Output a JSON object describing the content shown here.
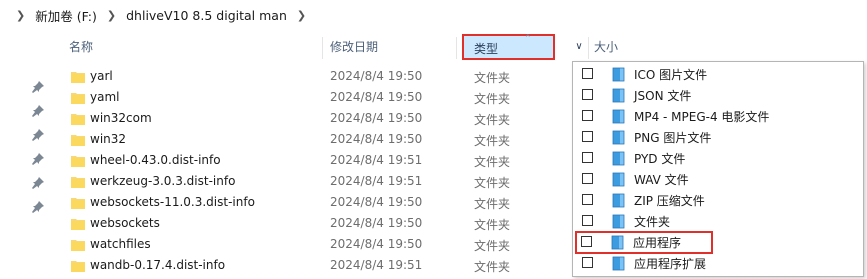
{
  "breadcrumb": {
    "drive": "新加卷 (F:)",
    "folder": "dhliveV10 8.5 digital man"
  },
  "columns": {
    "name": "名称",
    "date": "修改日期",
    "type": "类型",
    "size": "大小"
  },
  "files": [
    {
      "name": "yarl",
      "date": "2024/8/4 19:50",
      "type": "文件夹"
    },
    {
      "name": "yaml",
      "date": "2024/8/4 19:50",
      "type": "文件夹"
    },
    {
      "name": "win32com",
      "date": "2024/8/4 19:50",
      "type": "文件夹"
    },
    {
      "name": "win32",
      "date": "2024/8/4 19:50",
      "type": "文件夹"
    },
    {
      "name": "wheel-0.43.0.dist-info",
      "date": "2024/8/4 19:51",
      "type": "文件夹"
    },
    {
      "name": "werkzeug-3.0.3.dist-info",
      "date": "2024/8/4 19:51",
      "type": "文件夹"
    },
    {
      "name": "websockets-11.0.3.dist-info",
      "date": "2024/8/4 19:50",
      "type": "文件夹"
    },
    {
      "name": "websockets",
      "date": "2024/8/4 19:50",
      "type": "文件夹"
    },
    {
      "name": "watchfiles",
      "date": "2024/8/4 19:50",
      "type": "文件夹"
    },
    {
      "name": "wandb-0.17.4.dist-info",
      "date": "2024/8/4 19:51",
      "type": "文件夹"
    }
  ],
  "filter_options": [
    {
      "label": "ICO 图片文件",
      "checked": false
    },
    {
      "label": "JSON 文件",
      "checked": false
    },
    {
      "label": "MP4 - MPEG-4 电影文件",
      "checked": false
    },
    {
      "label": "PNG 图片文件",
      "checked": false
    },
    {
      "label": "PYD 文件",
      "checked": false
    },
    {
      "label": "WAV 文件",
      "checked": false
    },
    {
      "label": "ZIP 压缩文件",
      "checked": false
    },
    {
      "label": "文件夹",
      "checked": false
    },
    {
      "label": "应用程序",
      "checked": false
    },
    {
      "label": "应用程序扩展",
      "checked": false
    }
  ],
  "colors": {
    "header_text": "#4c607a",
    "selected_column_bg": "#cce8ff",
    "highlight_border": "#e0302c",
    "folder_yellow": "#f8d775",
    "filetype_icon_blue": "#3d9be0"
  }
}
